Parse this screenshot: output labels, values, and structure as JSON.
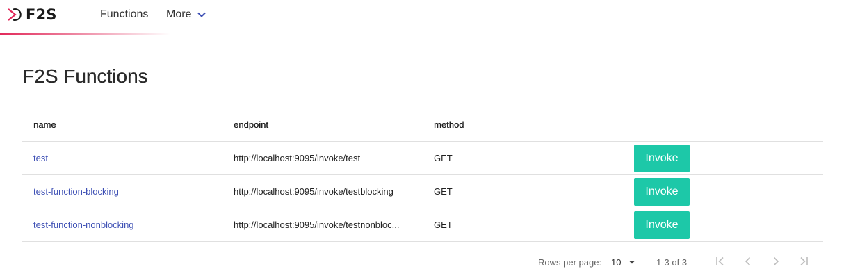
{
  "header": {
    "logo_text": "F2S",
    "nav": {
      "functions_label": "Functions",
      "more_label": "More"
    },
    "accent_color": "#e2295a"
  },
  "page": {
    "title": "F2S Functions"
  },
  "table": {
    "columns": {
      "name": "name",
      "endpoint": "endpoint",
      "method": "method"
    },
    "rows": [
      {
        "name": "test",
        "endpoint": "http://localhost:9095/invoke/test",
        "method": "GET",
        "action_label": "Invoke"
      },
      {
        "name": "test-function-blocking",
        "endpoint": "http://localhost:9095/invoke/testblocking",
        "method": "GET",
        "action_label": "Invoke"
      },
      {
        "name": "test-function-nonblocking",
        "endpoint": "http://localhost:9095/invoke/testnonbloc...",
        "method": "GET",
        "action_label": "Invoke"
      }
    ],
    "link_color": "#3f51b5",
    "button_color": "#1dc8a8"
  },
  "pagination": {
    "rows_per_page_label": "Rows per page:",
    "rows_per_page_value": "10",
    "range_text": "1-3 of 3",
    "icons": [
      "first-page-icon",
      "previous-page-icon",
      "next-page-icon",
      "last-page-icon"
    ]
  }
}
